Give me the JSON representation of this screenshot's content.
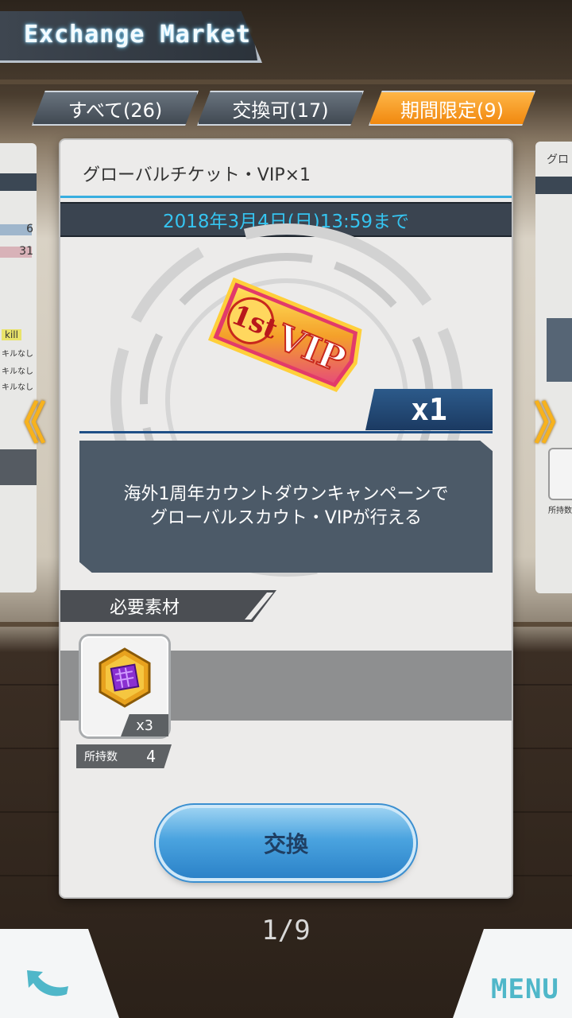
{
  "header": {
    "title": "Exchange Market"
  },
  "tabs": [
    {
      "label": "すべて(26)",
      "active": false
    },
    {
      "label": "交換可(17)",
      "active": false
    },
    {
      "label": "期間限定(9)",
      "active": true
    }
  ],
  "side_left": {
    "stats": [
      "6",
      "31"
    ],
    "skill_header": "kill",
    "skill_lines": [
      "キルなし",
      "キルなし",
      "キルなし"
    ],
    "arrow": "《"
  },
  "side_right": {
    "label": "グロ",
    "holder": "所持数",
    "arrow": "》"
  },
  "card": {
    "item_name": "グローバルチケット・VIP×1",
    "deadline": "2018年3月4日(日)13:59まで",
    "ticket_text_top": "1st",
    "ticket_text_main": "VIP",
    "quantity": "x1",
    "description_line1": "海外1周年カウントダウンキャンペーンで",
    "description_line2": "グローバルスカウト・VIPが行える",
    "required_header": "必要素材",
    "material_count": "x3",
    "owned_label": "所持数",
    "owned_value": "4",
    "exchange_label": "交換"
  },
  "pagination": {
    "text": "1/9"
  },
  "nav": {
    "menu_label": "MENU"
  },
  "colors": {
    "accent_orange": "#f0860c",
    "accent_cyan": "#35c4f0",
    "button_blue": "#4aa3df",
    "menu_teal": "#4fb7c9"
  }
}
